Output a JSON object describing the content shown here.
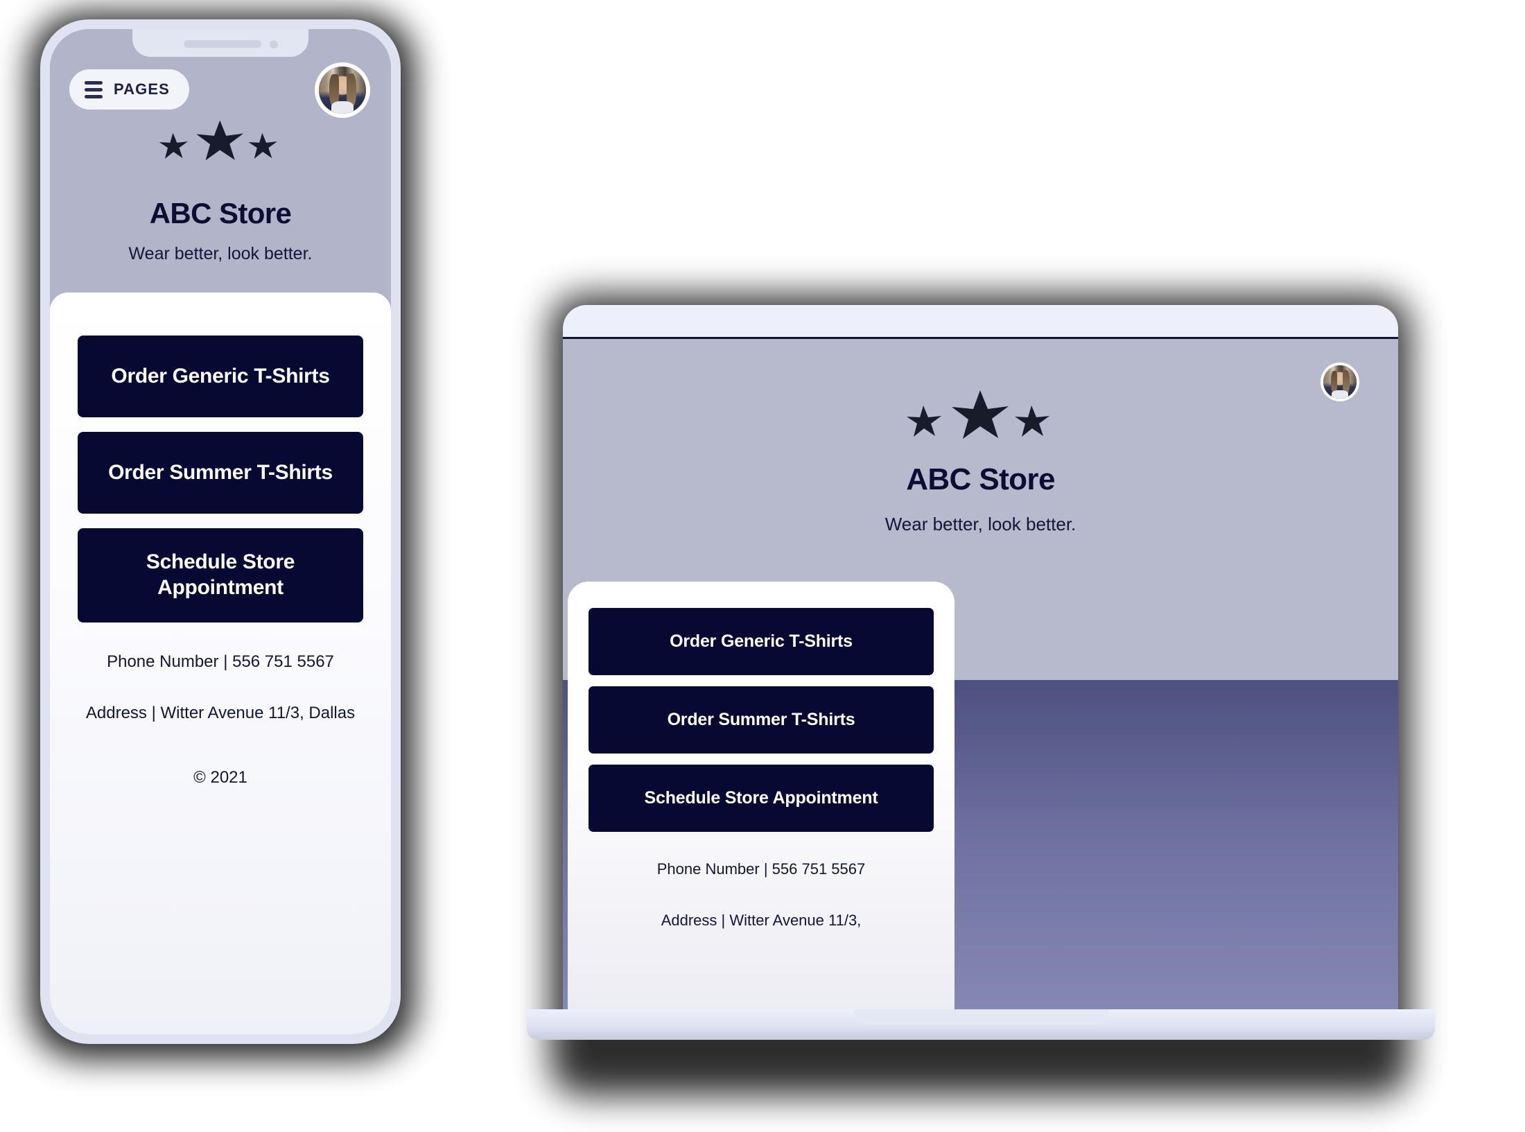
{
  "brand": {
    "name": "ABC Store",
    "tagline": "Wear better, look better.",
    "logo_icon": "three-stars-icon",
    "accent_dark": "#060a33",
    "hero_bg": "#b2b4c9",
    "card_bg": "#ffffff",
    "text_dark": "#0b0d33"
  },
  "phone": {
    "nav": {
      "menu_label": "PAGES",
      "menu_icon": "hamburger-icon",
      "avatar_icon": "user-avatar"
    },
    "title": "ABC Store",
    "tagline": "Wear better, look better.",
    "buttons": [
      {
        "label": "Order Generic T-Shirts"
      },
      {
        "label": "Order Summer T-Shirts"
      },
      {
        "label": "Schedule Store Appointment"
      }
    ],
    "contact": {
      "phone": "Phone Number | 556 751 5567",
      "address": "Address | Witter Avenue 11/3, Dallas"
    },
    "copyright": "© 2021",
    "hardware": {
      "speaker_icon": "speaker-grille-icon",
      "camera_icon": "front-camera-icon"
    }
  },
  "laptop": {
    "nav": {
      "avatar_icon": "user-avatar"
    },
    "title": "ABC Store",
    "tagline": "Wear better, look better.",
    "buttons": [
      {
        "label": "Order Generic T-Shirts"
      },
      {
        "label": "Order Summer T-Shirts"
      },
      {
        "label": "Schedule Store Appointment"
      }
    ],
    "contact": {
      "phone": "Phone Number | 556 751 5567",
      "address": "Address | Witter Avenue 11/3,"
    }
  }
}
